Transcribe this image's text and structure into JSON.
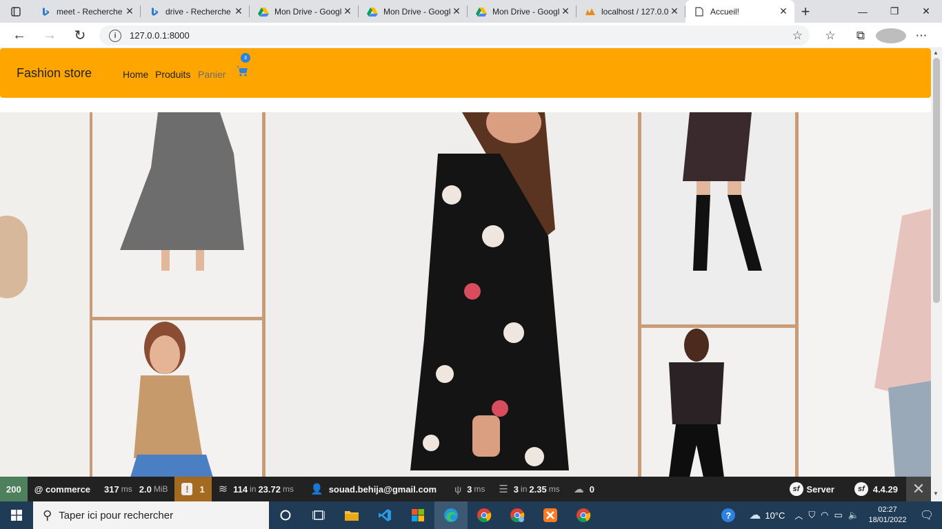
{
  "browser": {
    "tabs": [
      {
        "title": "meet - Recherche",
        "icon": "bing-icon"
      },
      {
        "title": "drive - Recherche",
        "icon": "bing-icon"
      },
      {
        "title": "Mon Drive - Google",
        "icon": "google-drive-icon"
      },
      {
        "title": "Mon Drive - Google",
        "icon": "google-drive-icon"
      },
      {
        "title": "Mon Drive - Google",
        "icon": "google-drive-icon"
      },
      {
        "title": "localhost / 127.0.0",
        "icon": "phpmyadmin-icon"
      },
      {
        "title": "Accueil!",
        "icon": "page-icon",
        "active": true
      }
    ],
    "url": "127.0.0.1:8000"
  },
  "navbar": {
    "brand": "Fashion store",
    "links": [
      "Home",
      "Produits",
      "Panier"
    ],
    "cart_count": "3",
    "background": "#ffa500"
  },
  "debug_toolbar": {
    "status": "200",
    "route": "@ commerce",
    "time_value": "317",
    "time_unit": "ms",
    "memory_value": "2.0",
    "memory_unit": "MiB",
    "warnings": "1",
    "cache_calls": "114",
    "cache_in": "in",
    "cache_time": "23.72",
    "cache_unit": "ms",
    "user": "souad.behija@gmail.com",
    "twig_time": "3",
    "twig_unit": "ms",
    "db_queries": "3",
    "db_in": "in",
    "db_time": "2.35",
    "db_unit": "ms",
    "uploads": "0",
    "server_label": "Server",
    "symfony_version": "4.4.29"
  },
  "taskbar": {
    "search_placeholder": "Taper ici pour rechercher",
    "weather": "10°C",
    "time": "02:27",
    "date": "18/01/2022"
  }
}
